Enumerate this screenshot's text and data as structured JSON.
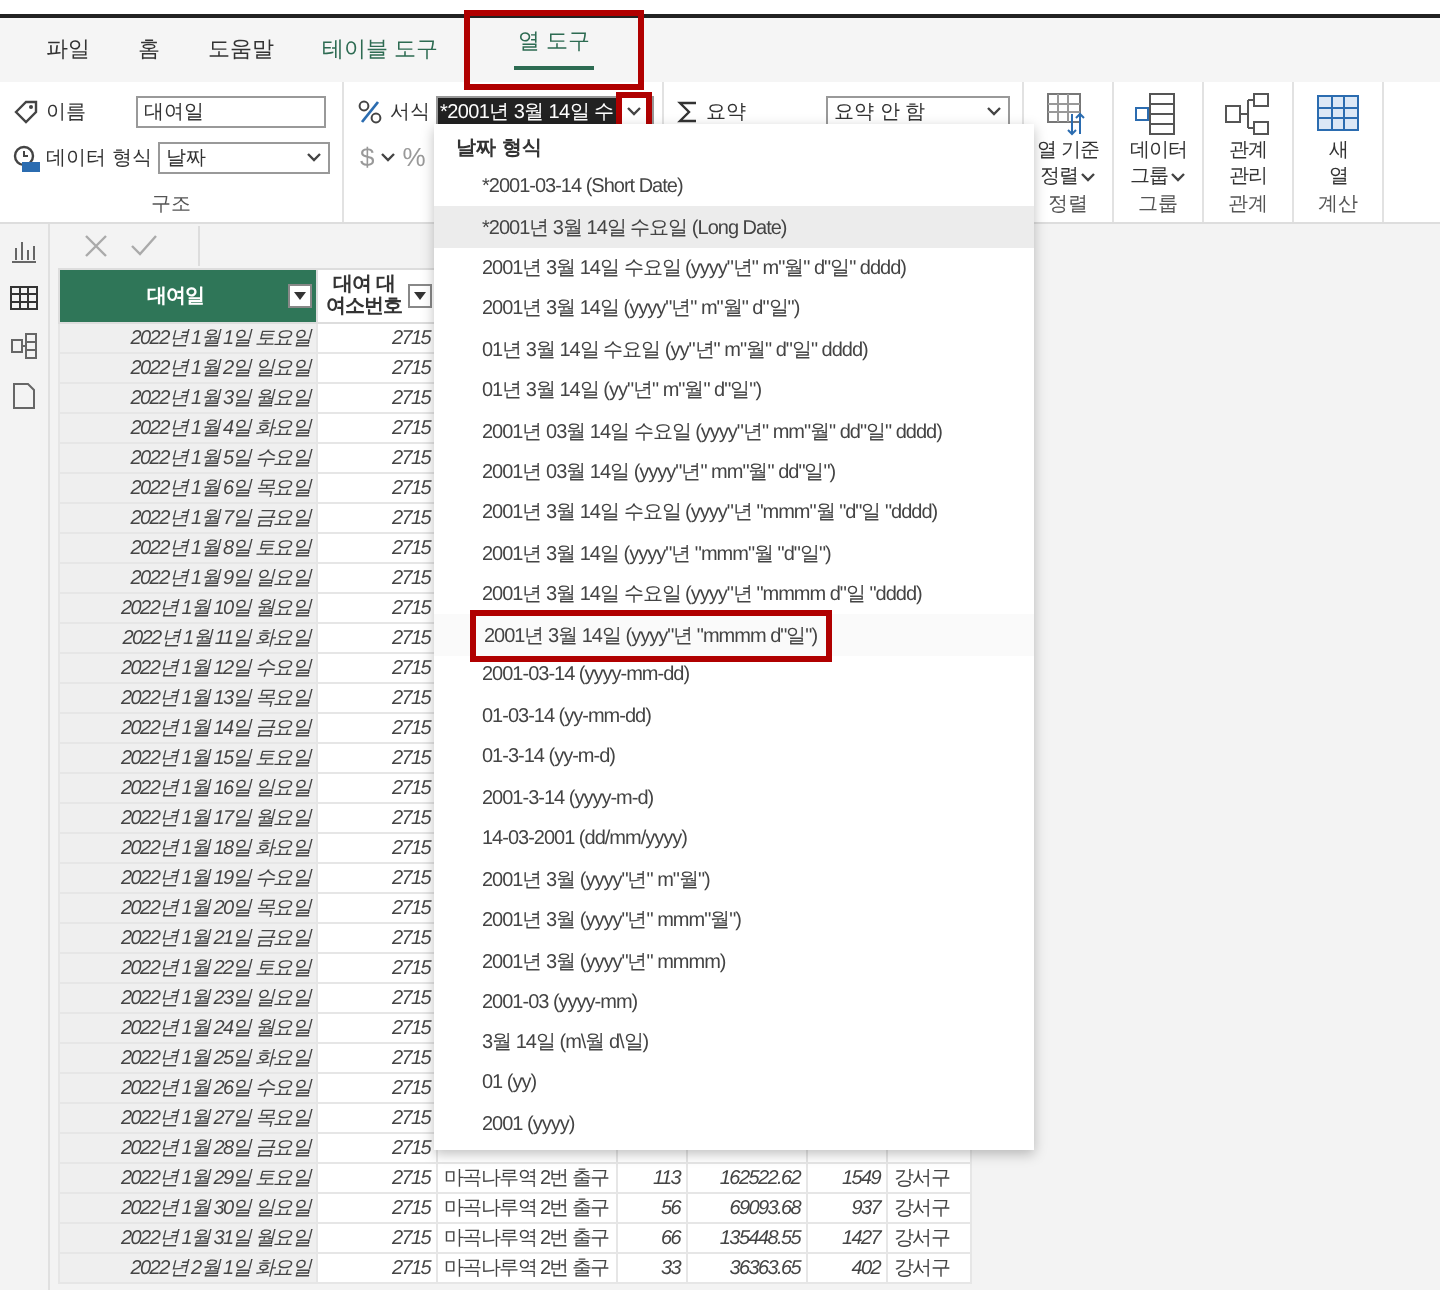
{
  "tabs": [
    {
      "label": "파일",
      "selected": false,
      "contextual": false,
      "highlighted": false
    },
    {
      "label": "홈",
      "selected": false,
      "contextual": false,
      "highlighted": false
    },
    {
      "label": "도움말",
      "selected": false,
      "contextual": false,
      "highlighted": false
    },
    {
      "label": "테이블 도구",
      "selected": false,
      "contextual": true,
      "highlighted": false
    },
    {
      "label": "열 도구",
      "selected": true,
      "contextual": true,
      "highlighted": true
    }
  ],
  "structure": {
    "name_label": "이름",
    "name_value": "대여일",
    "type_label": "데이터 형식",
    "type_value": "날짜",
    "group_label": "구조"
  },
  "formatting": {
    "format_label": "서식",
    "format_value": "*2001년 3월 14일 수",
    "arrow_highlighted": true,
    "currency": "$",
    "percent": "%"
  },
  "summary": {
    "label": "요약",
    "value": "요약 안 함"
  },
  "big_buttons": [
    {
      "kind": "sort",
      "lines": [
        "열 기준",
        "정렬"
      ],
      "caret": true,
      "group_label": "정렬"
    },
    {
      "kind": "group",
      "lines": [
        "데이터",
        "그룹"
      ],
      "caret": true,
      "group_label": "그룹"
    },
    {
      "kind": "relations",
      "lines": [
        "관계",
        "관리"
      ],
      "caret": false,
      "group_label": "관계"
    },
    {
      "kind": "newcol",
      "lines": [
        "새",
        "열"
      ],
      "caret": false,
      "group_label": "계산"
    }
  ],
  "table": {
    "columns": [
      {
        "label": "대여일",
        "selected": true
      },
      {
        "label": "대여 대여소번호",
        "selected": false
      }
    ],
    "rows": [
      {
        "cells": [
          "2022년 1월 1일 토요일",
          "2715"
        ]
      },
      {
        "cells": [
          "2022년 1월 2일 일요일",
          "2715"
        ]
      },
      {
        "cells": [
          "2022년 1월 3일 월요일",
          "2715"
        ]
      },
      {
        "cells": [
          "2022년 1월 4일 화요일",
          "2715"
        ]
      },
      {
        "cells": [
          "2022년 1월 5일 수요일",
          "2715"
        ]
      },
      {
        "cells": [
          "2022년 1월 6일 목요일",
          "2715"
        ]
      },
      {
        "cells": [
          "2022년 1월 7일 금요일",
          "2715"
        ]
      },
      {
        "cells": [
          "2022년 1월 8일 토요일",
          "2715"
        ]
      },
      {
        "cells": [
          "2022년 1월 9일 일요일",
          "2715"
        ]
      },
      {
        "cells": [
          "2022년 1월 10일 월요일",
          "2715"
        ]
      },
      {
        "cells": [
          "2022년 1월 11일 화요일",
          "2715"
        ]
      },
      {
        "cells": [
          "2022년 1월 12일 수요일",
          "2715"
        ]
      },
      {
        "cells": [
          "2022년 1월 13일 목요일",
          "2715"
        ]
      },
      {
        "cells": [
          "2022년 1월 14일 금요일",
          "2715"
        ]
      },
      {
        "cells": [
          "2022년 1월 15일 토요일",
          "2715"
        ]
      },
      {
        "cells": [
          "2022년 1월 16일 일요일",
          "2715"
        ]
      },
      {
        "cells": [
          "2022년 1월 17일 월요일",
          "2715"
        ]
      },
      {
        "cells": [
          "2022년 1월 18일 화요일",
          "2715"
        ]
      },
      {
        "cells": [
          "2022년 1월 19일 수요일",
          "2715"
        ]
      },
      {
        "cells": [
          "2022년 1월 20일 목요일",
          "2715"
        ]
      },
      {
        "cells": [
          "2022년 1월 21일 금요일",
          "2715"
        ]
      },
      {
        "cells": [
          "2022년 1월 22일 토요일",
          "2715"
        ]
      },
      {
        "cells": [
          "2022년 1월 23일 일요일",
          "2715"
        ]
      },
      {
        "cells": [
          "2022년 1월 24일 월요일",
          "2715"
        ]
      },
      {
        "cells": [
          "2022년 1월 25일 화요일",
          "2715"
        ]
      },
      {
        "cells": [
          "2022년 1월 26일 수요일",
          "2715"
        ]
      },
      {
        "cells": [
          "2022년 1월 27일 목요일",
          "2715"
        ]
      },
      {
        "cells": [
          "2022년 1월 28일 금요일",
          "2715"
        ]
      },
      {
        "cells": [
          "2022년 1월 29일 토요일",
          "2715",
          "마곡나루역 2번 출구",
          "113",
          "162522.62",
          "1549",
          "강서구"
        ]
      },
      {
        "cells": [
          "2022년 1월 30일 일요일",
          "2715",
          "마곡나루역 2번 출구",
          "56",
          "69093.68",
          "937",
          "강서구"
        ]
      },
      {
        "cells": [
          "2022년 1월 31일 월요일",
          "2715",
          "마곡나루역 2번 출구",
          "66",
          "135448.55",
          "1427",
          "강서구"
        ]
      },
      {
        "cells": [
          "2022년 2월 1일 화요일",
          "2715",
          "마곡나루역 2번 출구",
          "33",
          "36363.65",
          "402",
          "강서구"
        ]
      }
    ]
  },
  "format_dropdown": {
    "heading": "날짜 형식",
    "options": [
      {
        "label": "*2001-03-14 (Short Date)",
        "selected": false,
        "highlighted": false
      },
      {
        "label": "*2001년 3월 14일 수요일 (Long Date)",
        "selected": true,
        "highlighted": false
      },
      {
        "label": "2001년 3월 14일 수요일 (yyyy\"년\" m\"월\" d\"일\" dddd)",
        "selected": false,
        "highlighted": false
      },
      {
        "label": "2001년 3월 14일 (yyyy\"년\" m\"월\" d\"일\")",
        "selected": false,
        "highlighted": false
      },
      {
        "label": "01년 3월 14일 수요일 (yy\"년\" m\"월\" d\"일\" dddd)",
        "selected": false,
        "highlighted": false
      },
      {
        "label": "01년 3월 14일 (yy\"년\" m\"월\" d\"일\")",
        "selected": false,
        "highlighted": false
      },
      {
        "label": "2001년 03월 14일 수요일 (yyyy\"년\" mm\"월\" dd\"일\" dddd)",
        "selected": false,
        "highlighted": false
      },
      {
        "label": "2001년 03월 14일 (yyyy\"년\" mm\"월\" dd\"일\")",
        "selected": false,
        "highlighted": false
      },
      {
        "label": "2001년 3월 14일 수요일 (yyyy\"년 \"mmm\"월 \"d\"일 \"dddd)",
        "selected": false,
        "highlighted": false
      },
      {
        "label": "2001년 3월 14일 (yyyy\"년 \"mmm\"월 \"d\"일\")",
        "selected": false,
        "highlighted": false
      },
      {
        "label": "2001년 3월 14일 수요일 (yyyy\"년 \"mmmm d\"일 \"dddd)",
        "selected": false,
        "highlighted": false
      },
      {
        "label": "2001년 3월 14일 (yyyy\"년 \"mmmm d\"일\")",
        "selected": false,
        "highlighted": true
      },
      {
        "label": "2001-03-14 (yyyy-mm-dd)",
        "selected": false,
        "highlighted": false
      },
      {
        "label": "01-03-14 (yy-mm-dd)",
        "selected": false,
        "highlighted": false
      },
      {
        "label": "01-3-14 (yy-m-d)",
        "selected": false,
        "highlighted": false
      },
      {
        "label": "2001-3-14 (yyyy-m-d)",
        "selected": false,
        "highlighted": false
      },
      {
        "label": "14-03-2001 (dd/mm/yyyy)",
        "selected": false,
        "highlighted": false
      },
      {
        "label": "2001년 3월 (yyyy\"년\" m\"월\")",
        "selected": false,
        "highlighted": false
      },
      {
        "label": "2001년 3월 (yyyy\"년\" mmm\"월\")",
        "selected": false,
        "highlighted": false
      },
      {
        "label": "2001년 3월 (yyyy\"년\" mmmm)",
        "selected": false,
        "highlighted": false
      },
      {
        "label": "2001-03 (yyyy-mm)",
        "selected": false,
        "highlighted": false
      },
      {
        "label": "3월 14일 (m\\월 d\\일)",
        "selected": false,
        "highlighted": false
      },
      {
        "label": "01 (yy)",
        "selected": false,
        "highlighted": false
      },
      {
        "label": "2001 (yyyy)",
        "selected": false,
        "highlighted": false
      }
    ]
  }
}
